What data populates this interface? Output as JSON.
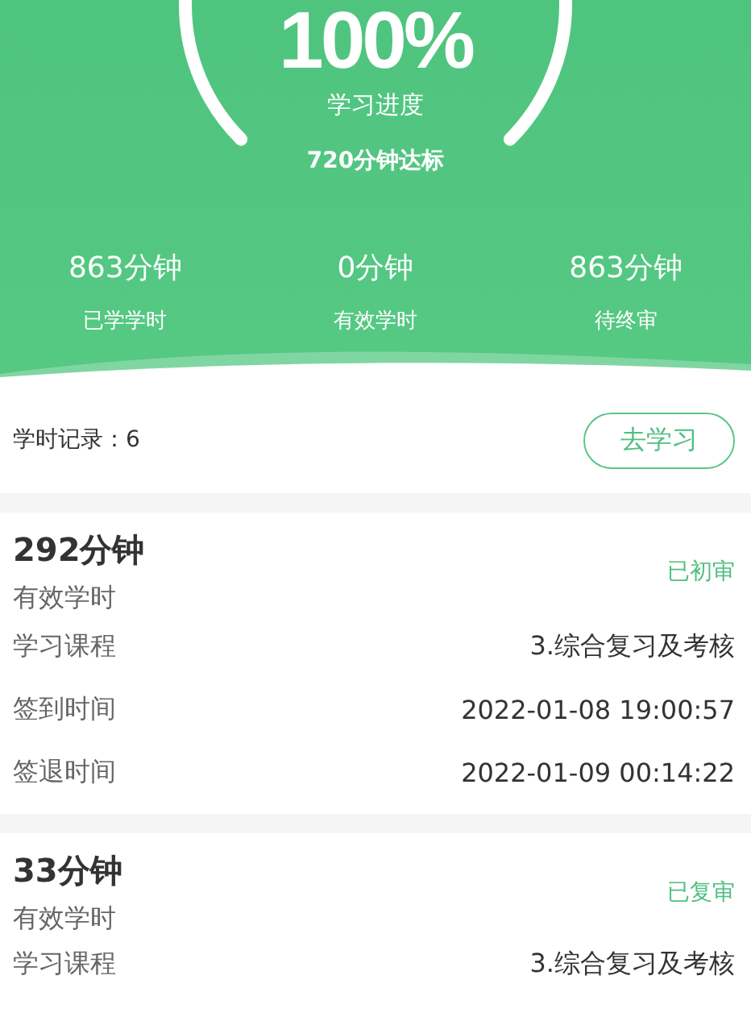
{
  "gauge": {
    "percent": "100%",
    "label": "学习进度",
    "target": "720分钟达标"
  },
  "stats": [
    {
      "value": "863分钟",
      "label": "已学学时"
    },
    {
      "value": "0分钟",
      "label": "有效学时"
    },
    {
      "value": "863分钟",
      "label": "待终审"
    }
  ],
  "records_bar": {
    "label": "学时记录：6",
    "button": "去学习"
  },
  "records": [
    {
      "minutes": "292分钟",
      "minutes_label": "有效学时",
      "status": "已初审",
      "rows": [
        {
          "label": "学习课程",
          "value": "3.综合复习及考核"
        },
        {
          "label": "签到时间",
          "value": "2022-01-08 19:00:57"
        },
        {
          "label": "签退时间",
          "value": "2022-01-09 00:14:22"
        }
      ]
    },
    {
      "minutes": "33分钟",
      "minutes_label": "有效学时",
      "status": "已复审",
      "rows": [
        {
          "label": "学习课程",
          "value": "3.综合复习及考核"
        }
      ]
    }
  ]
}
